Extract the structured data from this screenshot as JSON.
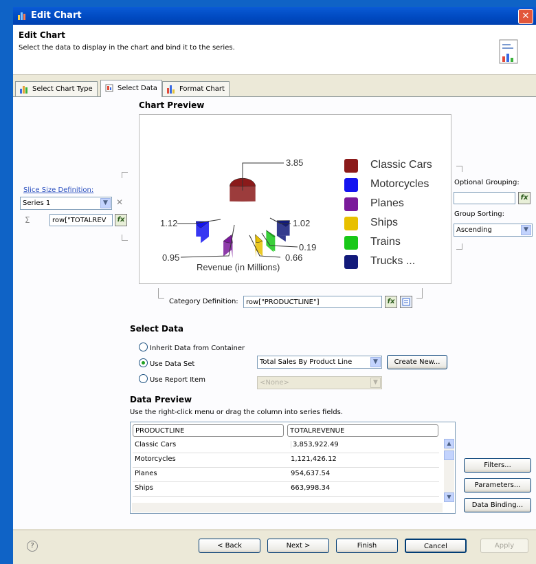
{
  "window": {
    "title": "Edit Chart",
    "close_glyph": "✕"
  },
  "header": {
    "title": "Edit Chart",
    "description": "Select the data to display in the chart and bind it to the series."
  },
  "tabs": [
    {
      "label": "Select Chart Type"
    },
    {
      "label": "Select Data"
    },
    {
      "label": "Format Chart"
    }
  ],
  "chart_section_title": "Chart Preview",
  "chart_data": {
    "type": "pie",
    "xlabel": "Revenue (in Millions)",
    "categories": [
      "Classic Cars",
      "Motorcycles",
      "Planes",
      "Ships",
      "Trains",
      "Trucks ..."
    ],
    "values": [
      3.85,
      1.12,
      0.95,
      0.66,
      0.19,
      1.02
    ],
    "colors": [
      "#8b1a1a",
      "#1414f0",
      "#7a1a9a",
      "#e8c000",
      "#18c818",
      "#121a7a"
    ],
    "legend": "right"
  },
  "chart_labels": {
    "classic_cars": "3.85",
    "motorcycles": "1.12",
    "planes": "0.95",
    "ships": "0.66",
    "trains": "0.19",
    "trucks": "1.02"
  },
  "slice_size": {
    "label": "Slice Size Definition:",
    "series_value": "Series 1",
    "sigma": "Σ",
    "expression": "row[\"TOTALREV"
  },
  "optional_grouping": {
    "label": "Optional Grouping:",
    "value": ""
  },
  "group_sorting": {
    "label": "Group Sorting:",
    "value": "Ascending"
  },
  "category": {
    "label": "Category Definition:",
    "expression": "row[\"PRODUCTLINE\"]"
  },
  "select_data": {
    "title": "Select Data",
    "options": [
      {
        "label": "Inherit Data from Container"
      },
      {
        "label": "Use Data Set"
      },
      {
        "label": "Use Report Item"
      }
    ],
    "dataset_value": "Total Sales By Product Line",
    "create_new": "Create New...",
    "report_item_value": "<None>"
  },
  "data_preview": {
    "title": "Data Preview",
    "hint": "Use the right-click menu or drag the column into series fields.",
    "columns": [
      "PRODUCTLINE",
      "TOTALREVENUE"
    ],
    "rows": [
      [
        "Classic Cars",
        "3,853,922.49"
      ],
      [
        "Motorcycles",
        "1,121,426.12"
      ],
      [
        "Planes",
        "954,637.54"
      ],
      [
        "Ships",
        "663,998.34"
      ]
    ]
  },
  "side_buttons": {
    "filters": "Filters...",
    "parameters": "Parameters...",
    "data_binding": "Data Binding..."
  },
  "footer": {
    "back": "< Back",
    "next": "Next >",
    "finish": "Finish",
    "cancel": "Cancel",
    "apply": "Apply",
    "help": "?"
  }
}
